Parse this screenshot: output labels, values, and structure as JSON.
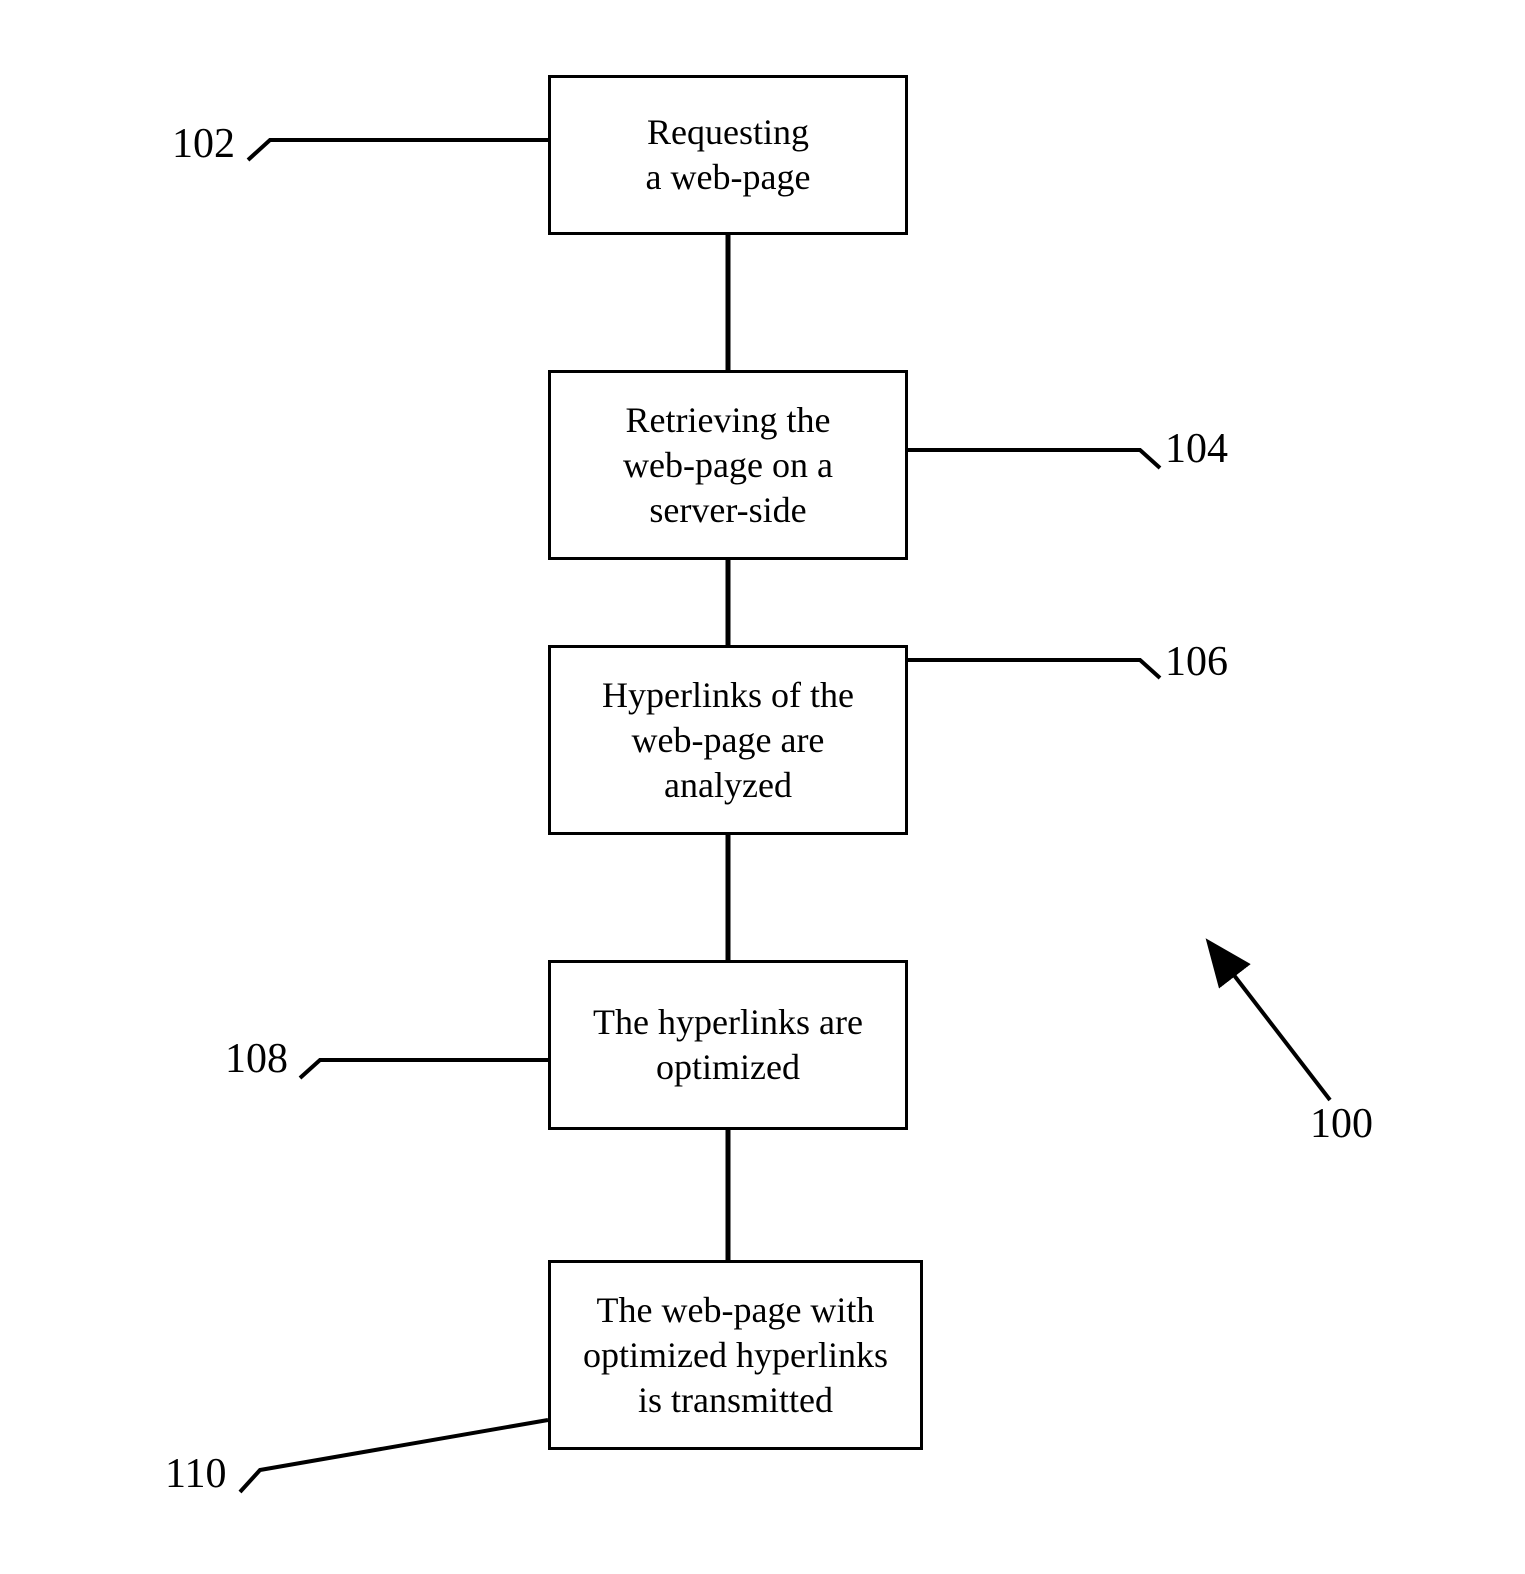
{
  "diagram": {
    "overall_ref": "100",
    "steps": [
      {
        "ref": "102",
        "text": "Requesting\na web-page"
      },
      {
        "ref": "104",
        "text": "Retrieving the\nweb-page on a\nserver-side"
      },
      {
        "ref": "106",
        "text": "Hyperlinks of the\nweb-page are\nanalyzed"
      },
      {
        "ref": "108",
        "text": "The hyperlinks are\noptimized"
      },
      {
        "ref": "110",
        "text": "The web-page with\noptimized hyperlinks\nis transmitted"
      }
    ]
  }
}
